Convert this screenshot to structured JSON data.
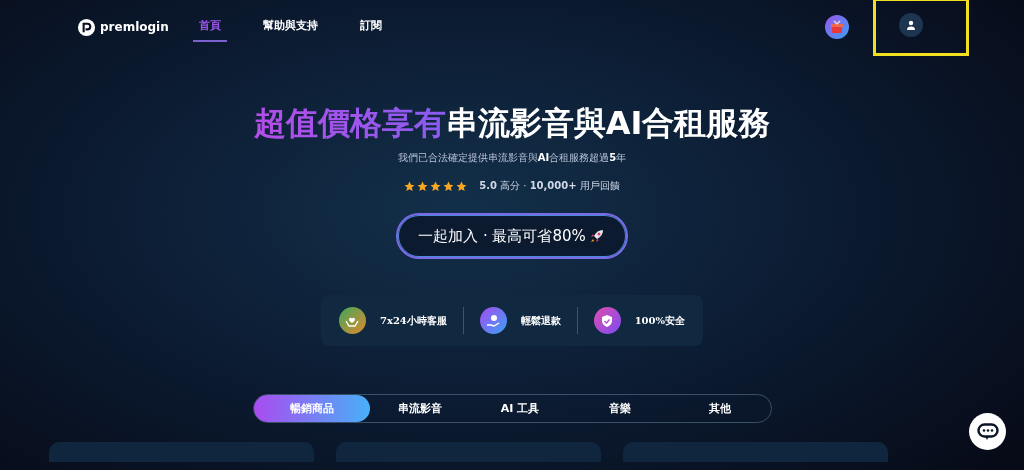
{
  "nav": {
    "brand": "premlogin",
    "links": [
      {
        "label": "首頁",
        "selected": true
      },
      {
        "label": "幫助與支持",
        "selected": false
      },
      {
        "label": "訂閱",
        "selected": false
      }
    ],
    "account": {
      "highlighted": true
    }
  },
  "hero": {
    "headline_accent": "超值價格享有",
    "headline_rest": "串流影音與AI合租服務",
    "subtitle": "我們已合法確定提供串流影音與**AI**合租服務超過**5**年",
    "stars": 5,
    "rating": "**5.0** 高分 · **10,000+** 用戶回饋",
    "cta": "一起加入 · 最高可省80%"
  },
  "features": [
    {
      "label": "7x24小時客服",
      "kind": "support"
    },
    {
      "label": "輕鬆退款",
      "kind": "refund"
    },
    {
      "label": "100%安全",
      "kind": "secure"
    }
  ],
  "categories": [
    {
      "label": "暢銷商品",
      "selected": true
    },
    {
      "label": "串流影音",
      "selected": false
    },
    {
      "label": "AI 工具",
      "selected": false
    },
    {
      "label": "音樂",
      "selected": false
    },
    {
      "label": "其他",
      "selected": false
    }
  ]
}
